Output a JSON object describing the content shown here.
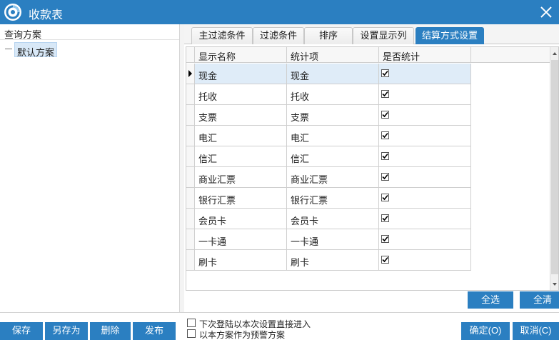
{
  "window": {
    "title": "收款表",
    "logo_icon": "app-logo-icon",
    "close_icon": "close-icon"
  },
  "left": {
    "header": "查询方案",
    "tree": [
      {
        "label": "默认方案",
        "selected": true
      }
    ]
  },
  "tabs": [
    {
      "label": "主过滤条件",
      "active": false
    },
    {
      "label": "过滤条件",
      "active": false
    },
    {
      "label": "排序",
      "active": false
    },
    {
      "label": "设置显示列",
      "active": false
    },
    {
      "label": "结算方式设置",
      "active": true
    }
  ],
  "grid": {
    "columns": [
      "显示名称",
      "统计项",
      "是否统计"
    ],
    "rows": [
      {
        "name": "现金",
        "item": "现金",
        "checked": true,
        "current": true
      },
      {
        "name": "托收",
        "item": "托收",
        "checked": true
      },
      {
        "name": "支票",
        "item": "支票",
        "checked": true
      },
      {
        "name": "电汇",
        "item": "电汇",
        "checked": true
      },
      {
        "name": "信汇",
        "item": "信汇",
        "checked": true
      },
      {
        "name": "商业汇票",
        "item": "商业汇票",
        "checked": true
      },
      {
        "name": "银行汇票",
        "item": "银行汇票",
        "checked": true
      },
      {
        "name": "会员卡",
        "item": "会员卡",
        "checked": true
      },
      {
        "name": "一卡通",
        "item": "一卡通",
        "checked": true
      },
      {
        "name": "刷卡",
        "item": "刷卡",
        "checked": true
      }
    ]
  },
  "grid_buttons": {
    "select_all": "全选",
    "clear_all": "全清"
  },
  "left_buttons": {
    "save": "保存",
    "save_as": "另存为",
    "delete": "删除",
    "publish": "发布"
  },
  "options": [
    {
      "label": "下次登陆以本次设置直接进入",
      "checked": false
    },
    {
      "label": "以本方案作为预警方案",
      "checked": false
    }
  ],
  "dialog_buttons": {
    "ok": "确定(O)",
    "cancel": "取消(C)"
  },
  "colors": {
    "accent": "#2b7fc1",
    "selected_row": "#dfecf8"
  }
}
